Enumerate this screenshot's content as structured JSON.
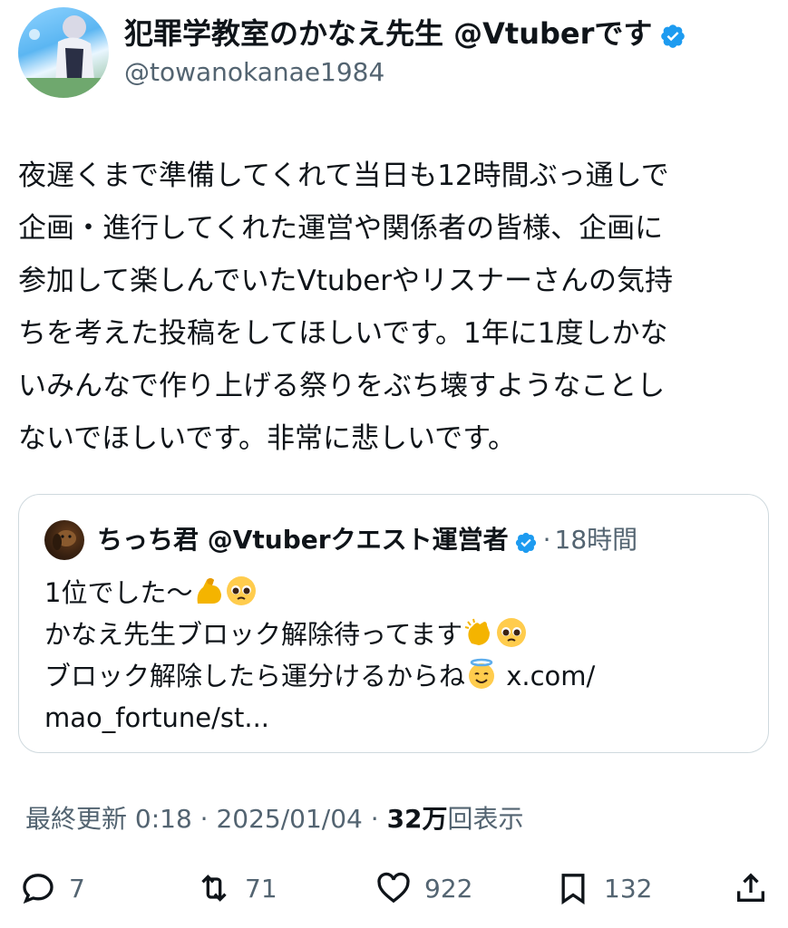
{
  "author": {
    "display_name": "犯罪学教室のかなえ先生 @Vtuberです",
    "handle": "@towanokanae1984",
    "verified_color": "#1d9bf0"
  },
  "tweet": {
    "text": "夜遅くまで準備してくれて当日も12時間ぶっ通しで\n企画・進行してくれた運営や関係者の皆様、企画に\n参加して楽しんでいたVtuberやリスナーさんの気持\nちを考えた投稿をしてほしいです。1年に1度しかな\nいみんなで作り上げる祭りをぶち壊すようなことし\nないでほしいです。非常に悲しいです。"
  },
  "quote": {
    "display_name": "ちっち君 @Vtuberクエスト運営者",
    "separator": "·",
    "time": "18時間",
    "line1": "1位でした〜",
    "line2": "かなえ先生ブロック解除待ってます",
    "line3": "ブロック解除したら運分けるからね",
    "link": "x.com/",
    "line4": "mao_fortune/st..."
  },
  "meta": {
    "updated": "最終更新 0:18 · 2025/01/04 ·",
    "views_count": "32万",
    "views_label": "回表示"
  },
  "actions": {
    "reply_count": "7",
    "retweet_count": "71",
    "like_count": "922",
    "bookmark_count": "132"
  },
  "icons": [
    "verified-icon",
    "reply-icon",
    "retweet-icon",
    "like-icon",
    "bookmark-icon",
    "share-icon",
    "flexed-biceps-emoji",
    "pleading-face-emoji",
    "clapping-hands-emoji",
    "smiling-halo-emoji"
  ]
}
